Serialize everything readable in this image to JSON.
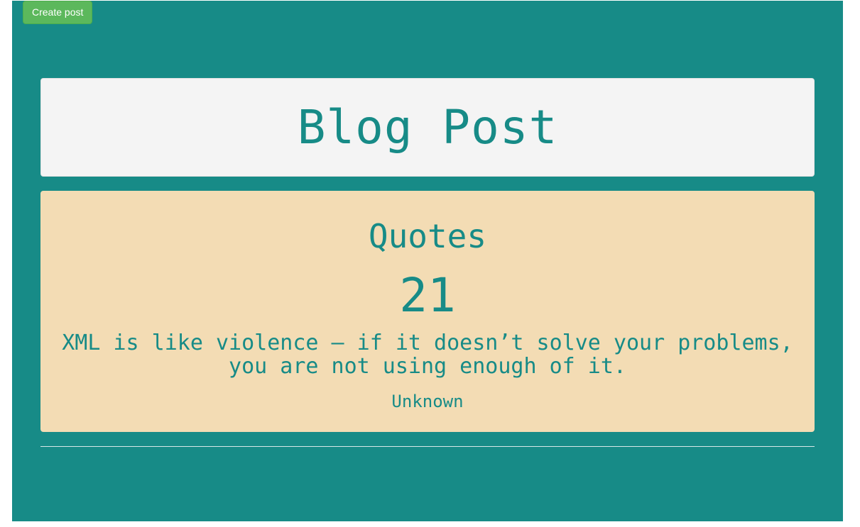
{
  "toolbar": {
    "create_post_label": "Create post"
  },
  "header": {
    "title": "Blog Post"
  },
  "quote_card": {
    "heading": "Quotes",
    "count": "21",
    "text": "XML is like violence – if it doesn’t solve your problems, you are not using enough of it.",
    "author": "Unknown"
  },
  "colors": {
    "page_background": "#178b87",
    "button_green": "#5cb85c",
    "header_background": "#f4f4f4",
    "card_background": "#f3dcb4",
    "text_accent": "#178b87"
  }
}
